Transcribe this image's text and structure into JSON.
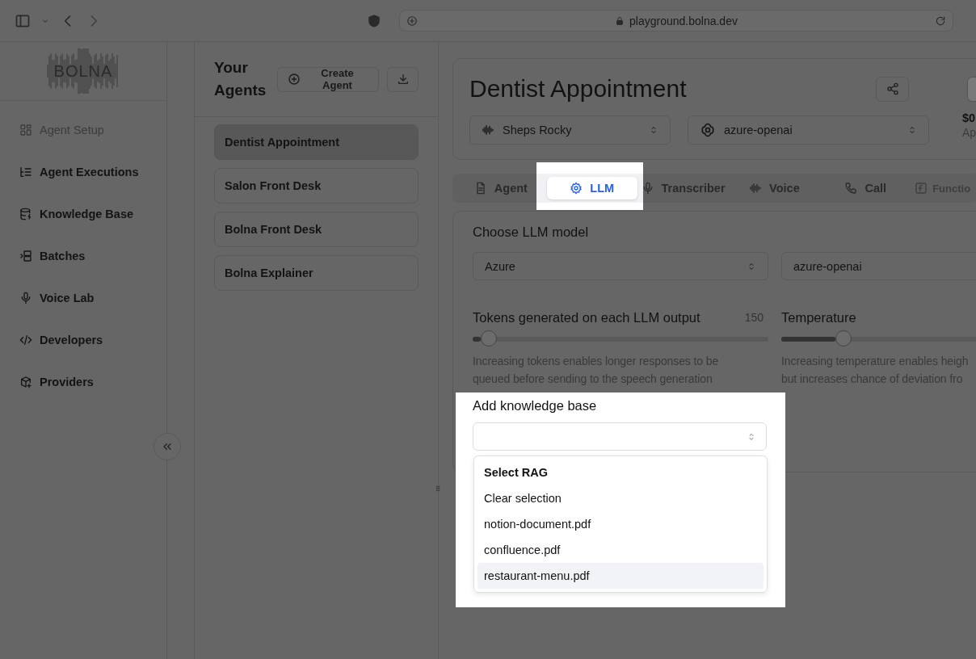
{
  "browser": {
    "url": "playground.bolna.dev"
  },
  "sidebar": {
    "logo": "BOLNA",
    "items": [
      {
        "label": "Agent Setup",
        "selected": true
      },
      {
        "label": "Agent Executions",
        "selected": false
      },
      {
        "label": "Knowledge Base",
        "selected": false
      },
      {
        "label": "Batches",
        "selected": false
      },
      {
        "label": "Voice Lab",
        "selected": false
      },
      {
        "label": "Developers",
        "selected": false
      },
      {
        "label": "Providers",
        "selected": false
      }
    ]
  },
  "agents_panel": {
    "title": "Your Agents",
    "create_button": "Create Agent",
    "agents": [
      {
        "name": "Dentist Appointment",
        "selected": true
      },
      {
        "name": "Salon Front Desk",
        "selected": false
      },
      {
        "name": "Bolna Front Desk",
        "selected": false
      },
      {
        "name": "Bolna Explainer",
        "selected": false
      }
    ]
  },
  "agent_header": {
    "title": "Dentist Appointment",
    "voice_select": "Sheps Rocky",
    "llm_select": "azure-openai",
    "cost": "$0",
    "cost_label": "Ap"
  },
  "tabs": [
    {
      "label": "Agent",
      "selected": false,
      "disabled": false
    },
    {
      "label": "LLM",
      "selected": true,
      "disabled": false
    },
    {
      "label": "Transcriber",
      "selected": false,
      "disabled": false
    },
    {
      "label": "Voice",
      "selected": false,
      "disabled": false
    },
    {
      "label": "Call",
      "selected": false,
      "disabled": false
    },
    {
      "label": "Functio",
      "selected": false,
      "disabled": true
    }
  ],
  "llm_settings": {
    "section_title": "Choose LLM model",
    "provider_select": "Azure",
    "model_select": "azure-openai",
    "sliders": [
      {
        "label": "Tokens generated on each LLM output",
        "reading": "150",
        "level": 0.055,
        "help": "Increasing tokens enables longer responses to be\nqueued before sending to the speech generation"
      },
      {
        "label": "Temperature",
        "level": 0.21,
        "help": "Increasing temperature enables heigh\nbut increases chance of deviation fro"
      }
    ]
  },
  "knowledge_base": {
    "label": "Add knowledge base",
    "menu_heading": "Select RAG",
    "options": [
      {
        "label": "Clear selection",
        "selected": false
      },
      {
        "label": "notion-document.pdf",
        "selected": false
      },
      {
        "label": "confluence.pdf",
        "selected": false
      },
      {
        "label": "restaurant-menu.pdf",
        "selected": true
      }
    ]
  }
}
